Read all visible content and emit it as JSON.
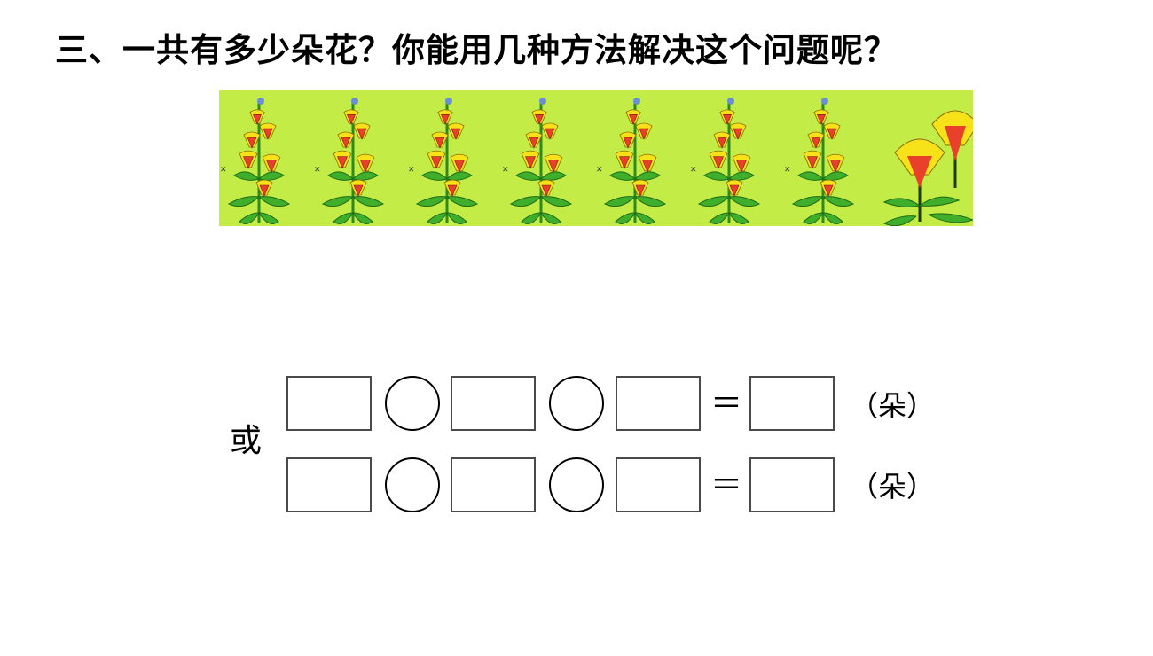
{
  "question": {
    "title": "三、一共有多少朵花？你能用几种方法解决这个问题呢？"
  },
  "picture": {
    "description_icon": "flower-plants-illustration",
    "tall_plants": 7,
    "small_plants": 1,
    "colors": {
      "background": "#c4ec46",
      "leaf": "#3fae2a",
      "petal_yellow": "#f7e21a",
      "petal_red": "#e8402a"
    }
  },
  "equations": {
    "or_label": "或",
    "rows": [
      {
        "equals": "＝",
        "unit": "（朵）"
      },
      {
        "equals": "＝",
        "unit": "（朵）"
      }
    ]
  }
}
